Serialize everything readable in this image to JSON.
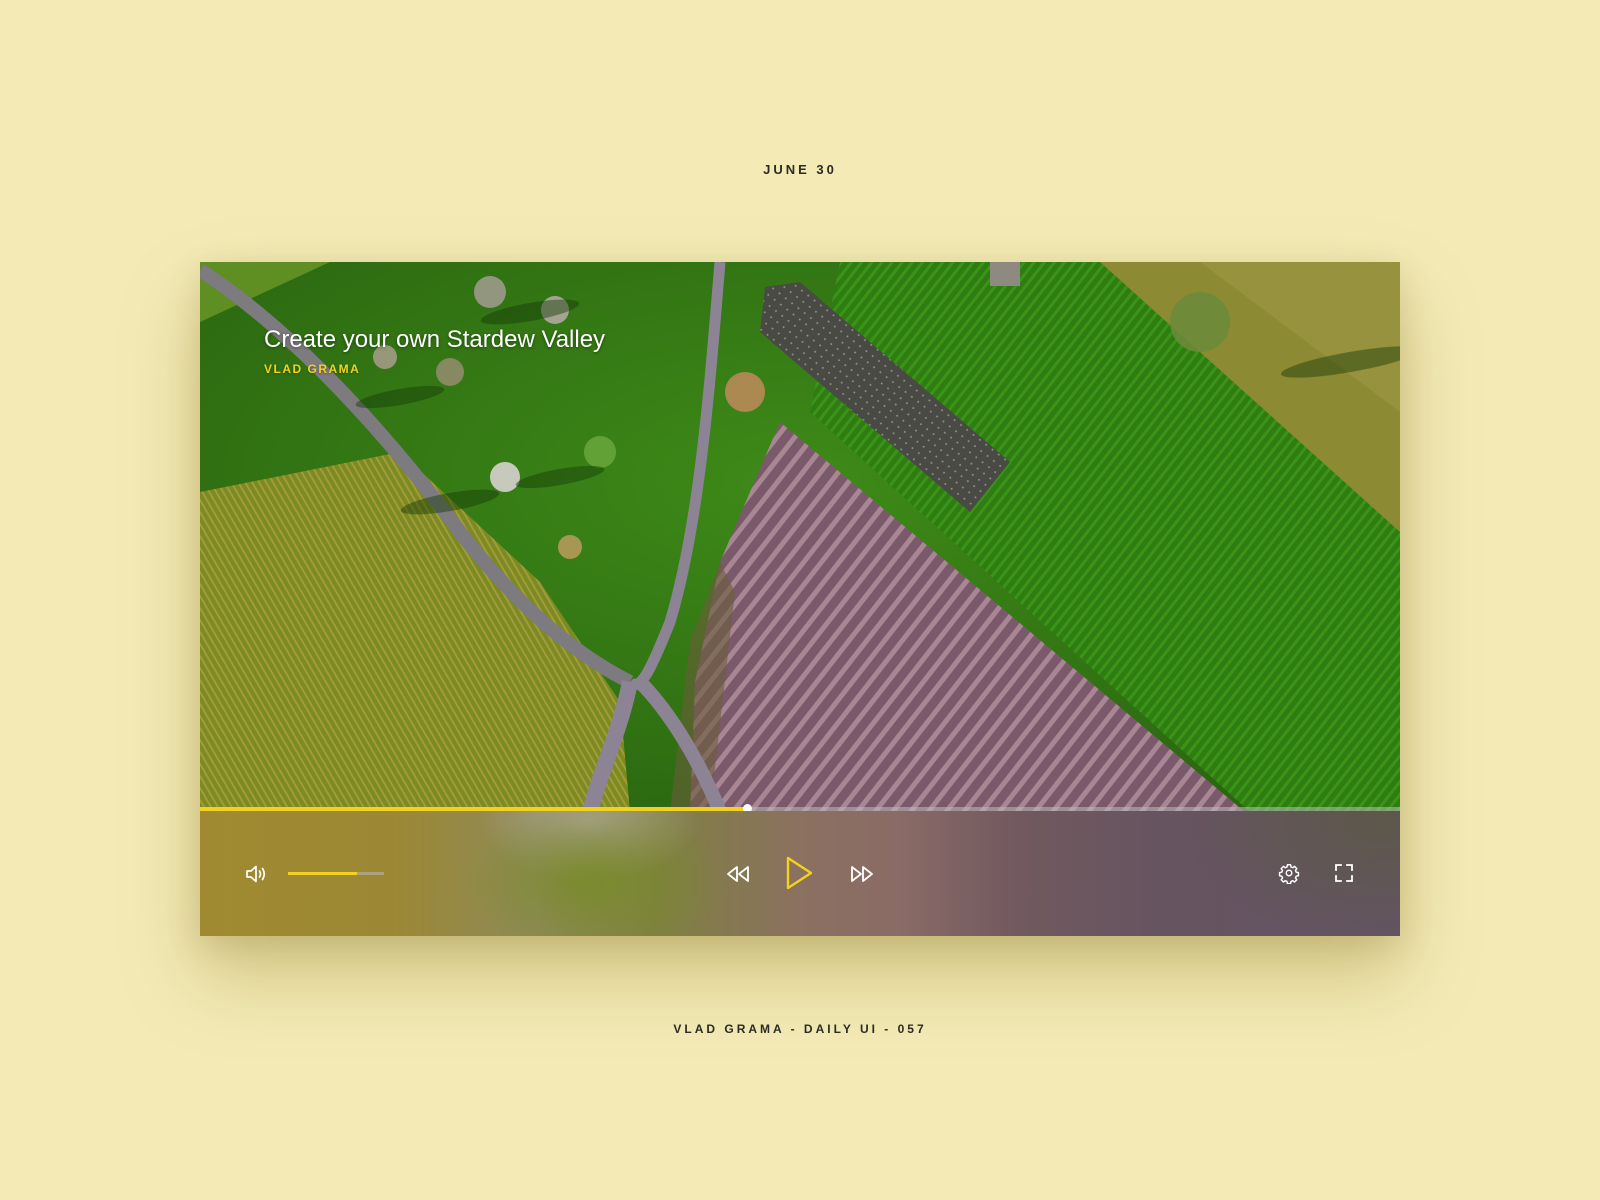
{
  "header": {
    "date": "JUNE 30"
  },
  "player": {
    "title": "Create your own Stardew Valley",
    "author": "VLAD GRAMA",
    "progress_fraction": 0.456,
    "volume_fraction": 0.72,
    "state": "paused",
    "colors": {
      "accent": "#f2d21e",
      "background": "#f3eab6"
    },
    "icons": {
      "volume": "volume-icon",
      "rewind": "rewind-icon",
      "play": "play-icon",
      "forward": "fast-forward-icon",
      "settings": "gear-icon",
      "fullscreen": "fullscreen-icon"
    }
  },
  "footer": {
    "credit": "VLAD GRAMA - DAILY UI - 057"
  }
}
